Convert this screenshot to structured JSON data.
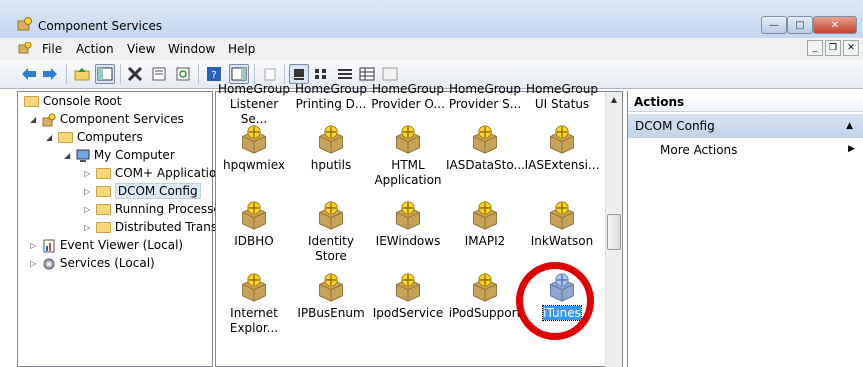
{
  "window": {
    "title": "Component Services"
  },
  "menu": [
    {
      "label": "File"
    },
    {
      "label": "Action"
    },
    {
      "label": "View"
    },
    {
      "label": "Window"
    },
    {
      "label": "Help"
    }
  ],
  "tree": {
    "root": "Console Root",
    "component_services": "Component Services",
    "computers": "Computers",
    "my_computer": "My Computer",
    "children": [
      "COM+ Applications",
      "DCOM Config",
      "Running Processes",
      "Distributed Transac"
    ],
    "event_viewer": "Event Viewer (Local)",
    "services": "Services (Local)"
  },
  "items": [
    [
      "Listener Se...",
      "Printing D...",
      "Provider O...",
      "Provider S...",
      "UI Status"
    ],
    [
      "hpqwmiex",
      "hputils",
      "HTML Application",
      "IASDataSto...",
      "IASExtensi..."
    ],
    [
      "IDBHO",
      "Identity Store",
      "IEWindows",
      "IMAPI2",
      "InkWatson"
    ],
    [
      "Internet Explor...",
      "IPBusEnum",
      "IpodService",
      "iPodSupport",
      "iTunes"
    ]
  ],
  "header_row_top": [
    "HomeGroup",
    "HomeGroup",
    "HomeGroup",
    "HomeGroup",
    "HomeGroup"
  ],
  "actions": {
    "title": "Actions",
    "section": "DCOM Config",
    "more": "More Actions"
  },
  "colors": {
    "accent": "#3399ff",
    "highlight_circle": "#e00000"
  }
}
